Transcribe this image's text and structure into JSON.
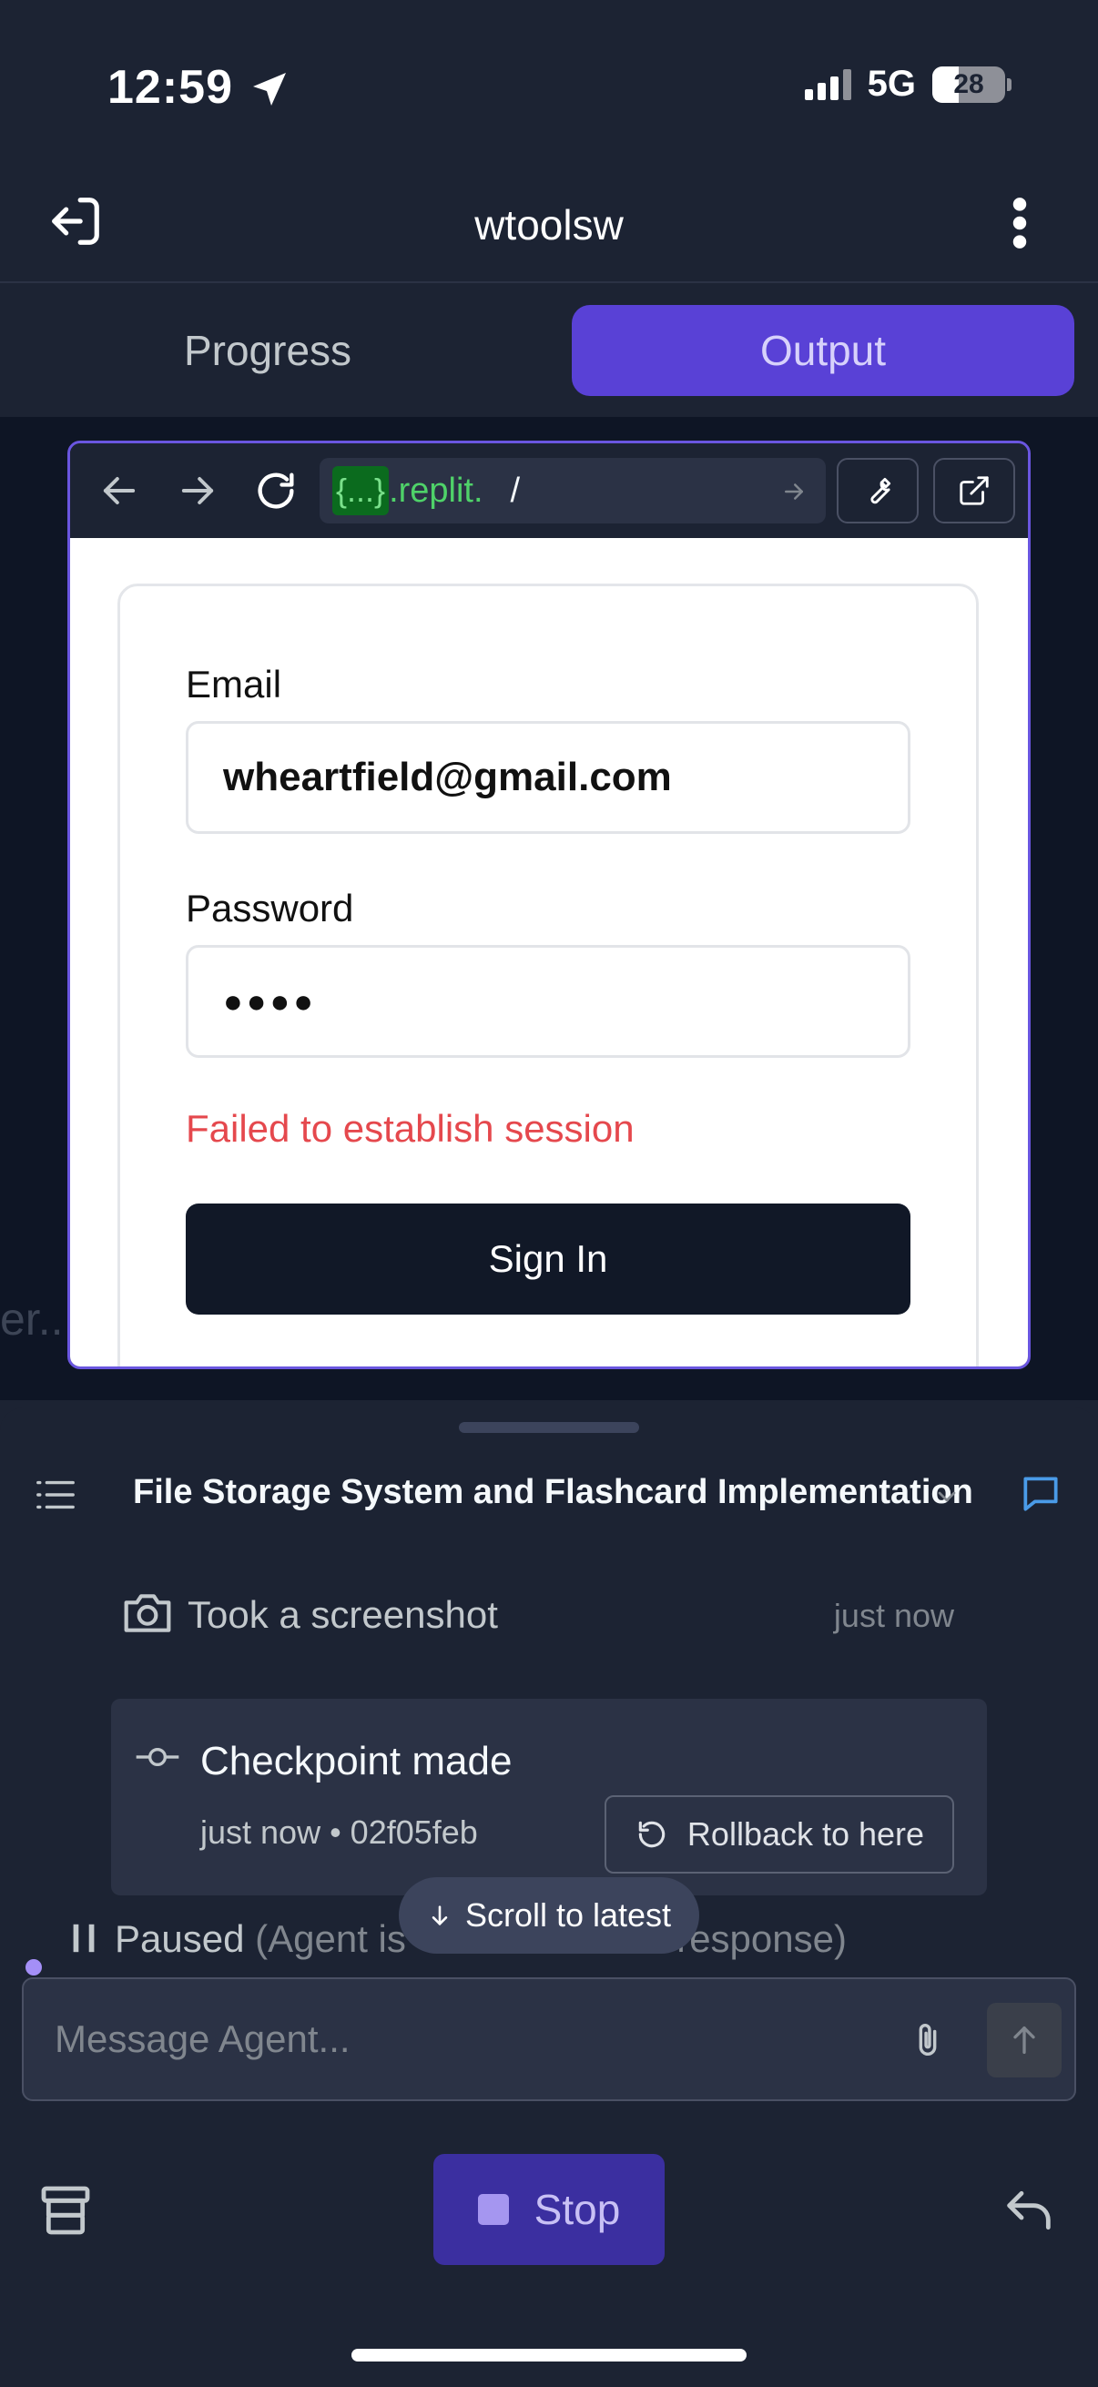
{
  "status_bar": {
    "time": "12:59",
    "network": "5G",
    "battery": "28"
  },
  "header": {
    "title": "wtoolsw"
  },
  "tabs": [
    {
      "label": "Progress"
    },
    {
      "label": "Output"
    }
  ],
  "output": {
    "ghost_text": "er.."
  },
  "browser": {
    "url_brace": "{...}",
    "url_host": ".replit.",
    "url_path": "/",
    "form": {
      "email_label": "Email",
      "email_value": "wheartfield@gmail.com",
      "password_label": "Password",
      "password_value": "●●●●",
      "error_message": "Failed to establish session",
      "signin_label": "Sign In"
    }
  },
  "agent": {
    "thread_title": "File Storage System and Flashcard Implementation",
    "screenshot_text": "Took a screenshot",
    "screenshot_time": "just now",
    "checkpoint": {
      "title": "Checkpoint made",
      "meta": "just now • 02f05feb",
      "rollback_label": "Rollback to here"
    },
    "paused_text": "Paused",
    "paused_detail": "(Agent is",
    "paused_detail_end": "r response)",
    "scroll_label": "Scroll to latest",
    "message_placeholder": "Message Agent...",
    "stop_label": "Stop"
  }
}
